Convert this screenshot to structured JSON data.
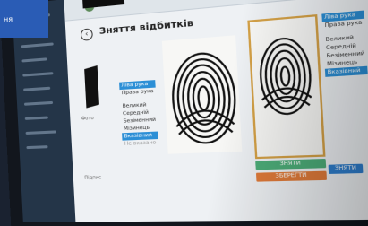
{
  "overlay": {
    "text": "ня"
  },
  "page": {
    "title": "Зняття відбитків"
  },
  "hand_options": [
    "Ліва рука",
    "Права рука"
  ],
  "finger_options": [
    "Великий",
    "Середній",
    "Безіменний",
    "Мізинець",
    "Вказівний",
    "Не вказано"
  ],
  "finger_options_right": [
    "Ліва рука",
    "Права рука",
    "Великий",
    "Середній",
    "Безіменний",
    "Мізинець",
    "Вказівний"
  ],
  "labels": {
    "photo": "Фото",
    "signature": "Підпис"
  },
  "buttons": {
    "capture": "ЗНЯТИ",
    "save": "ЗБЕРЕГТИ",
    "upload": "ЗНЯТИ"
  },
  "colors": {
    "accent": "#2c8fd6",
    "green": "#4dad79",
    "orange": "#e07b3a",
    "highlight_border": "#d4a147",
    "sidebar": "#243548"
  }
}
